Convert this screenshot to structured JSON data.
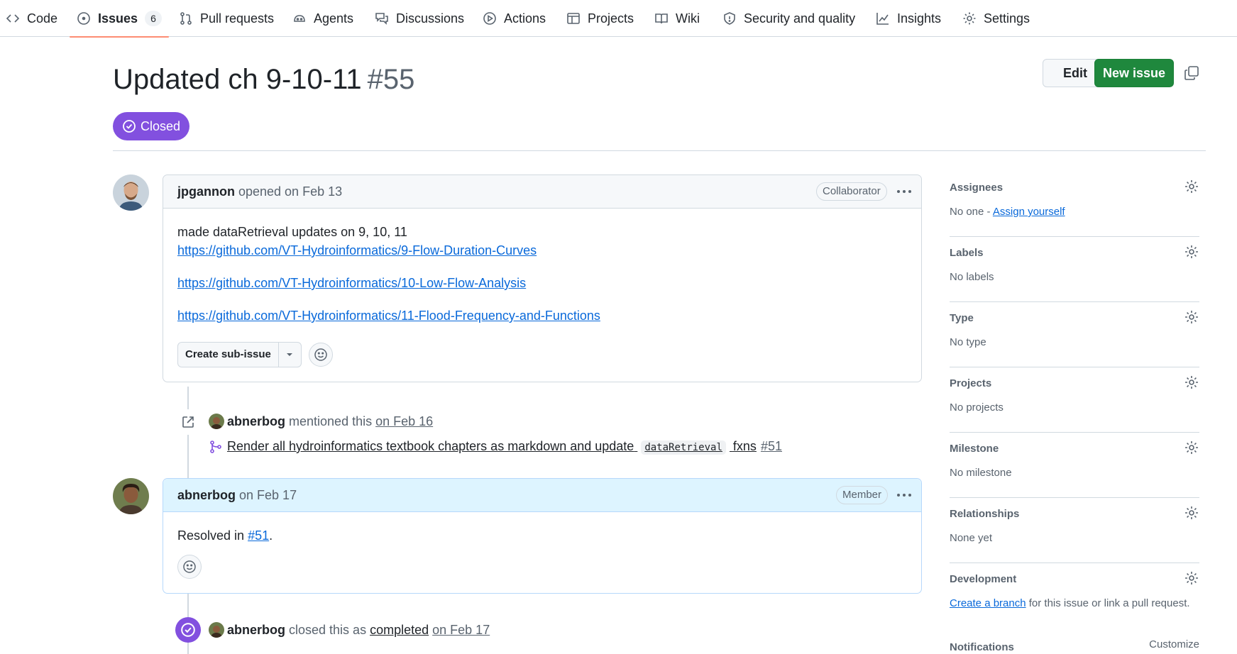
{
  "nav": {
    "items": [
      {
        "label": "Code",
        "icon": "code-icon"
      },
      {
        "label": "Issues",
        "icon": "issue-opened-icon",
        "count": "6",
        "active": true
      },
      {
        "label": "Pull requests",
        "icon": "git-pull-request-icon"
      },
      {
        "label": "Agents",
        "icon": "agent-icon"
      },
      {
        "label": "Discussions",
        "icon": "comment-discussion-icon"
      },
      {
        "label": "Actions",
        "icon": "play-icon"
      },
      {
        "label": "Projects",
        "icon": "table-icon"
      },
      {
        "label": "Wiki",
        "icon": "book-icon"
      },
      {
        "label": "Security and quality",
        "icon": "shield-icon"
      },
      {
        "label": "Insights",
        "icon": "graph-icon"
      },
      {
        "label": "Settings",
        "icon": "gear-icon"
      }
    ]
  },
  "issue": {
    "title": "Updated ch 9-10-11",
    "number": "#55",
    "state": "Closed",
    "edit_label": "Edit",
    "new_label": "New issue"
  },
  "comments": {
    "first": {
      "author": "jpgannon",
      "meta": "opened on Feb 13",
      "role": "Collaborator",
      "text": "made dataRetrieval updates on 9, 10, 11",
      "links": [
        "https://github.com/VT-Hydroinformatics/9-Flow-Duration-Curves",
        "https://github.com/VT-Hydroinformatics/10-Low-Flow-Analysis",
        "https://github.com/VT-Hydroinformatics/11-Flood-Frequency-and-Functions"
      ],
      "sub_issue_label": "Create sub-issue"
    },
    "second": {
      "author": "abnerbog",
      "meta": "on Feb 17",
      "role": "Member",
      "text_prefix": "Resolved in ",
      "link": "#51",
      "text_suffix": "."
    }
  },
  "events": {
    "mention": {
      "who": "abnerbog",
      "action": "mentioned this",
      "date": "on Feb 16",
      "pr_title": "Render all hydroinformatics textbook chapters as markdown and update",
      "pr_code": "dataRetrieval",
      "pr_suffix": "fxns",
      "pr_number": "#51"
    },
    "closed": {
      "who": "abnerbog",
      "action": "closed this as",
      "state": "completed",
      "date": "on Feb 17"
    }
  },
  "sidebar": {
    "assignees": {
      "heading": "Assignees",
      "value": "No one -",
      "link": "Assign yourself"
    },
    "labels": {
      "heading": "Labels",
      "value": "No labels"
    },
    "type": {
      "heading": "Type",
      "value": "No type"
    },
    "projects": {
      "heading": "Projects",
      "value": "No projects"
    },
    "milestone": {
      "heading": "Milestone",
      "value": "No milestone"
    },
    "relationships": {
      "heading": "Relationships",
      "value": "None yet"
    },
    "development": {
      "heading": "Development",
      "link": "Create a branch",
      "value": "for this issue or link a pull request."
    },
    "notifications": {
      "heading": "Notifications",
      "customize": "Customize"
    }
  },
  "colors": {
    "accent": "#0969da",
    "closed": "#8250df",
    "new_issue": "#1f883d",
    "active_tab": "#fd8c73"
  }
}
